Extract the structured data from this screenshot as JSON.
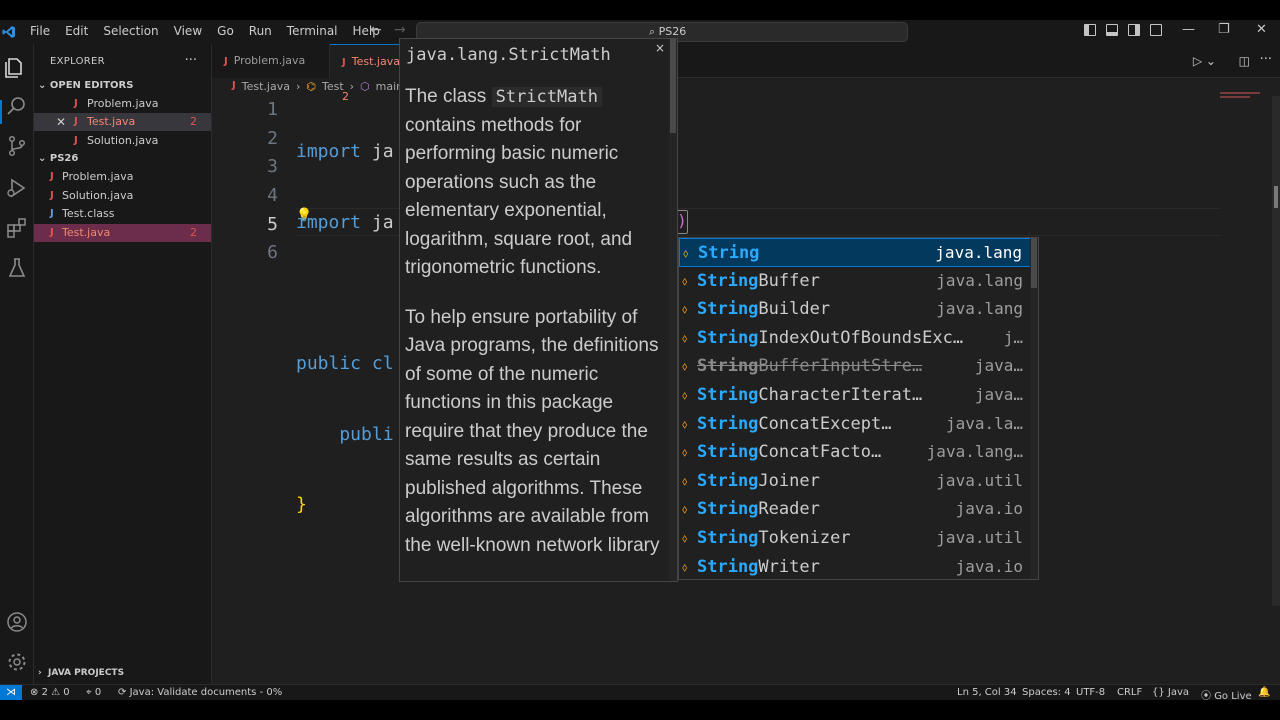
{
  "menu": [
    "File",
    "Edit",
    "Selection",
    "View",
    "Go",
    "Run",
    "Terminal",
    "Help"
  ],
  "search": {
    "text": "PS26"
  },
  "window_controls": {
    "minimize": "—",
    "restore": "❐",
    "close": "✕"
  },
  "sidebar": {
    "title": "EXPLORER",
    "more": "···",
    "open_editors_label": "OPEN EDITORS",
    "open_editors": [
      {
        "name": "Problem.java",
        "badge": ""
      },
      {
        "name": "Test.java",
        "badge": "2"
      },
      {
        "name": "Solution.java",
        "badge": ""
      }
    ],
    "folder_label": "PS26",
    "files": [
      {
        "name": "Problem.java",
        "badge": ""
      },
      {
        "name": "Solution.java",
        "badge": ""
      },
      {
        "name": "Test.class",
        "badge": ""
      },
      {
        "name": "Test.java",
        "badge": "2"
      }
    ],
    "java_projects": "JAVA PROJECTS"
  },
  "tabs": [
    {
      "label": "Problem.java"
    },
    {
      "label": "Test.java",
      "badge": "2"
    }
  ],
  "breadcrumb": [
    "Test.java",
    "Test",
    "main()"
  ],
  "editor": {
    "line_numbers": [
      "1",
      "2",
      "3",
      "4",
      "5",
      "6"
    ],
    "lines": [
      {
        "kw": "import",
        "rest": " ja"
      },
      {
        "kw": "import",
        "rest": " ja"
      },
      {
        "kw": "",
        "rest": ""
      },
      {
        "kw": "public",
        "rest": " cl"
      },
      {
        "kw": "    publi",
        "rest": ""
      },
      {
        "kw": "",
        "rest": "}"
      }
    ],
    "caret_char": ")"
  },
  "hover": {
    "title": "java.lang.StrictMath",
    "close": "×",
    "p1_before": "The class ",
    "p1_code": "StrictMath",
    "p1_after": " contains methods for performing basic numeric operations such as the elementary exponential, logarithm, square root, and trigonometric functions.",
    "p2": "To help ensure portability of Java programs, the definitions of some of the numeric functions in this package require that they produce the same results as certain published algorithms. These algorithms are available from the well-known network library"
  },
  "suggestions": [
    {
      "match": "String",
      "rest": "",
      "detail": "java.lang",
      "focused": true
    },
    {
      "match": "String",
      "rest": "Buffer",
      "detail": "java.lang"
    },
    {
      "match": "String",
      "rest": "Builder",
      "detail": "java.lang"
    },
    {
      "match": "String",
      "rest": "IndexOutOfBoundsExc…",
      "detail": "j…"
    },
    {
      "match": "String",
      "rest": "BufferInputStre…",
      "detail": "java…",
      "deprecated": true
    },
    {
      "match": "String",
      "rest": "CharacterIterat…",
      "detail": "java…"
    },
    {
      "match": "String",
      "rest": "ConcatExcept…",
      "detail": "java.la…"
    },
    {
      "match": "String",
      "rest": "ConcatFacto…",
      "detail": "java.lang…"
    },
    {
      "match": "String",
      "rest": "Joiner",
      "detail": "java.util"
    },
    {
      "match": "String",
      "rest": "Reader",
      "detail": "java.io"
    },
    {
      "match": "String",
      "rest": "Tokenizer",
      "detail": "java.util"
    },
    {
      "match": "String",
      "rest": "Writer",
      "detail": "java.io"
    }
  ],
  "statusbar": {
    "errors": "2",
    "warnings": "0",
    "ports": "0",
    "java_status": "Java: Validate documents - 0%",
    "position": "Ln 5, Col 34",
    "spaces": "Spaces: 4",
    "encoding": "UTF-8",
    "eol": "CRLF",
    "language": "Java",
    "golive": "Go Live"
  },
  "colors": {
    "accent": "#0078d4",
    "error": "#e05252",
    "match": "#2aaaff",
    "keyword": "#569cd6"
  }
}
